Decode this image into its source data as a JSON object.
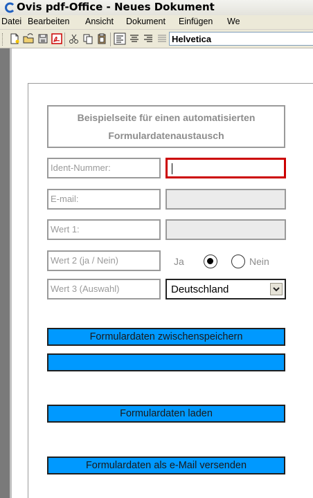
{
  "window": {
    "title": "Ovis pdf-Office - Neues Dokument"
  },
  "menu": {
    "items": [
      "Datei",
      "Bearbeiten",
      "Ansicht",
      "Dokument",
      "Einfügen",
      "We"
    ]
  },
  "toolbar": {
    "buttons": [
      "new-document-icon",
      "open-icon",
      "save-icon",
      "pdf-icon",
      "cut-icon",
      "copy-icon",
      "paste-icon",
      "align-left-icon",
      "align-center-icon",
      "align-right-icon",
      "justify-icon"
    ],
    "font_name": "Helvetica"
  },
  "form": {
    "header_line1": "Beispielseite für einen automatisierten",
    "header_line2": "Formulardatenaustausch",
    "fields": [
      {
        "label": "Ident-Nummer:",
        "value": "",
        "active": true
      },
      {
        "label": "E-mail:",
        "value": "",
        "active": false
      },
      {
        "label": "Wert 1:",
        "value": "",
        "active": false
      }
    ],
    "wert2": {
      "label": "Wert 2 (ja / Nein)",
      "option_yes": "Ja",
      "option_no": "Nein",
      "selected": "Ja"
    },
    "wert3": {
      "label": "Wert 3 (Auswahl)",
      "selected": "Deutschland"
    },
    "buttons": {
      "save_temp": "Formulardaten zwischenspeichern",
      "blank": "",
      "load": "Formulardaten laden",
      "email": "Formulardaten als e-Mail versenden"
    }
  },
  "colors": {
    "accent": "#0099ff",
    "focus_border": "#cc0000",
    "label_gray": "#9a9a9a"
  }
}
